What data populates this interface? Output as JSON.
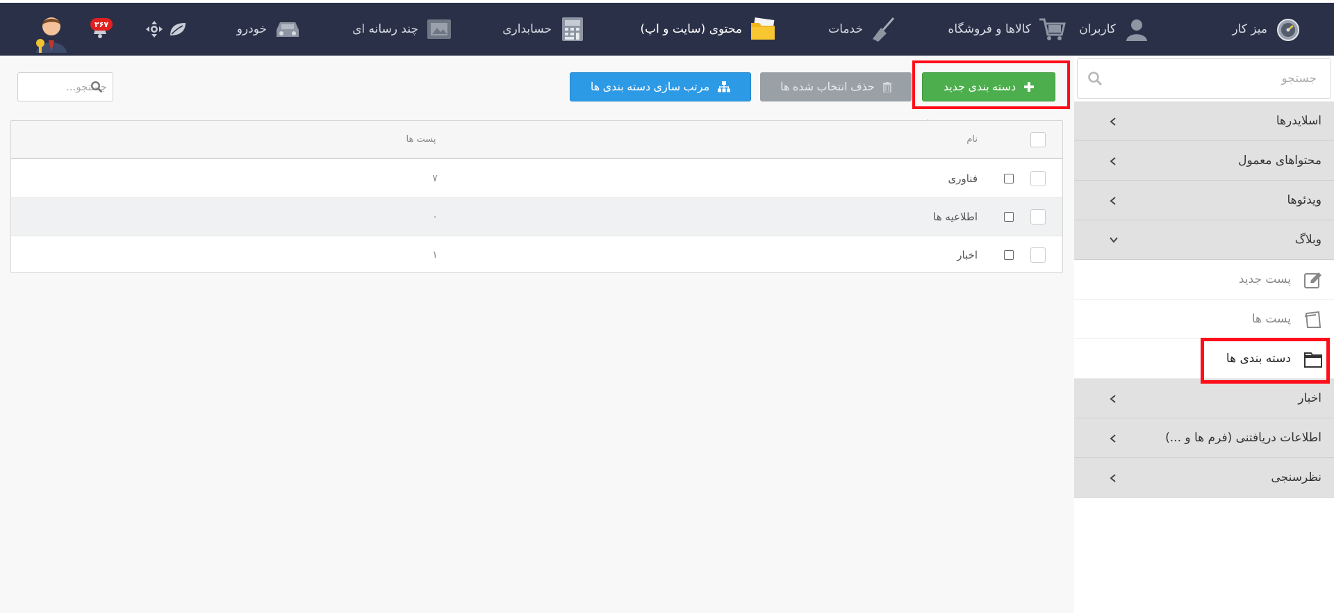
{
  "nav": {
    "items": [
      {
        "label": "میز کار",
        "icon": "speedometer-icon"
      },
      {
        "label": "کاربران",
        "icon": "user-icon"
      },
      {
        "label": "کالاها و فروشگاه",
        "icon": "cart-icon"
      },
      {
        "label": "خدمات",
        "icon": "broom-icon"
      },
      {
        "label": "محتوی (سایت و اپ)",
        "icon": "folder-icon"
      },
      {
        "label": "حسابداری",
        "icon": "calculator-icon"
      },
      {
        "label": "چند رسانه ای",
        "icon": "media-icon"
      },
      {
        "label": "خودرو",
        "icon": "car-icon"
      }
    ],
    "notification_count": "۳۶۷"
  },
  "sidebar": {
    "search_placeholder": "جستجو",
    "sections": [
      {
        "label": "اسلایدرها"
      },
      {
        "label": "محتواهای معمول"
      },
      {
        "label": "ویدئوها"
      },
      {
        "label": "وبلاگ"
      }
    ],
    "blog_items": [
      {
        "label": "پست جدید",
        "icon": "edit-icon"
      },
      {
        "label": "پست ها",
        "icon": "pages-icon"
      },
      {
        "label": "دسته بندی ها",
        "icon": "folder-icon"
      }
    ],
    "more_sections": [
      {
        "label": "اخبار"
      },
      {
        "label": "اطلاعات دریافتنی (فرم ها و ...)"
      },
      {
        "label": "نظرسنجی"
      }
    ]
  },
  "toolbar": {
    "new_category": "دسته بندی جدید",
    "delete_selected": "حذف انتخاب شده ها",
    "sort_categories": "مرتب سازی دسته بندی ها",
    "search_placeholder": "جستجو..."
  },
  "table": {
    "headers": {
      "name": "نام",
      "posts": "پست ها"
    },
    "rows": [
      {
        "name": "فناوری",
        "posts": "۷"
      },
      {
        "name": "اطلاعیه ها",
        "posts": "۰"
      },
      {
        "name": "اخبار",
        "posts": "۱"
      }
    ]
  },
  "colors": {
    "nav_bg": "#2a3047",
    "green": "#4cae4c",
    "blue": "#2d9ae6",
    "gray": "#9aa1a6",
    "highlight": "#ff0e1a"
  }
}
